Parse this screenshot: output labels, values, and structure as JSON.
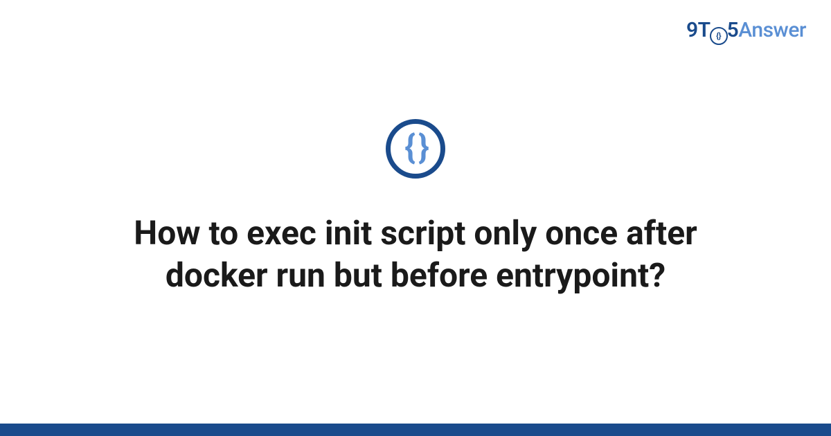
{
  "logo": {
    "part1": "9T",
    "part2": "5",
    "part3": "Answer",
    "circle_inner": "{}"
  },
  "icon": {
    "name": "code-braces-icon",
    "glyph": "{ }"
  },
  "question": {
    "title": "How to exec init script only once after docker run but before entrypoint?"
  },
  "colors": {
    "primary": "#1a4b8c",
    "accent": "#5a8fd4"
  }
}
